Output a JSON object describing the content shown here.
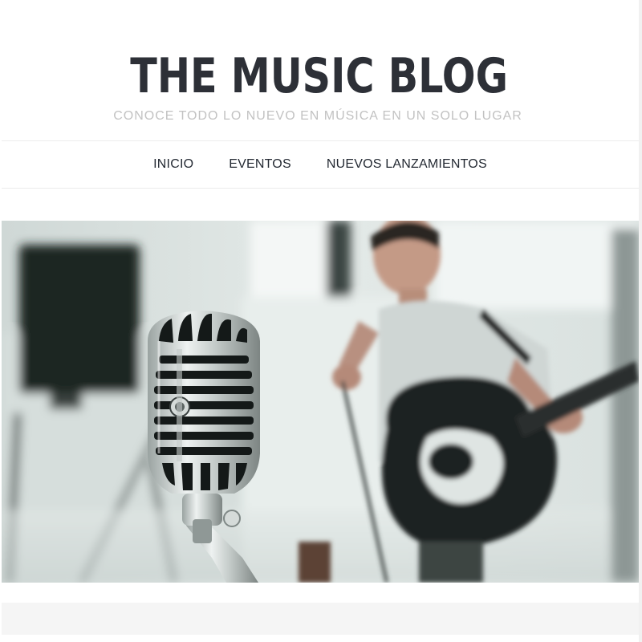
{
  "header": {
    "title": "THE MUSIC BLOG",
    "tagline": "CONOCE TODO LO NUEVO EN MÚSICA EN UN SOLO LUGAR"
  },
  "nav": {
    "items": [
      {
        "label": "INICIO"
      },
      {
        "label": "EVENTOS"
      },
      {
        "label": "NUEVOS LANZAMIENTOS"
      }
    ]
  },
  "hero": {
    "image": "microphone-and-guitarist-photo"
  },
  "colors": {
    "title": "#2d3037",
    "tagline": "#c2c2c2",
    "nav_text": "#242a33",
    "divider": "#ececec",
    "footer_strip": "#f5f5f5"
  }
}
